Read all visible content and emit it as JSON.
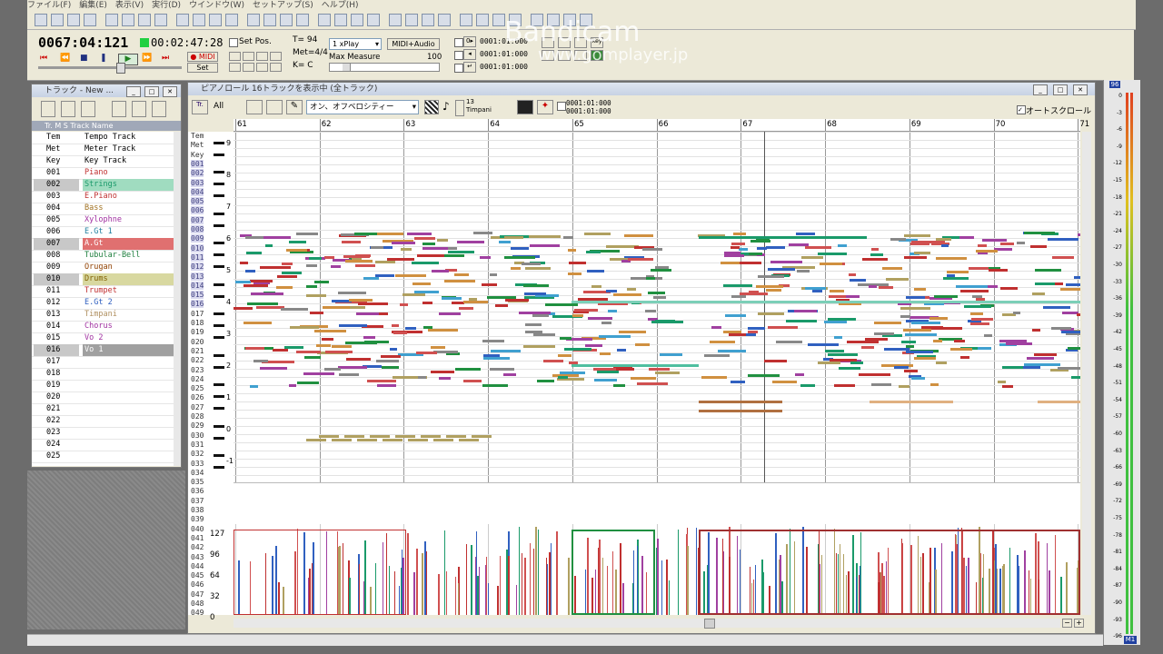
{
  "menu": [
    "ファイル(F)",
    "編集(E)",
    "表示(V)",
    "実行(D)",
    "ウインドウ(W)",
    "セットアップ(S)",
    "ヘルプ(H)"
  ],
  "transport": {
    "measure_pos": "0067:04:121",
    "time_pos": "00:02:47:28",
    "midi_label": "● MIDI",
    "set_label": "Set",
    "set_pos_label": "Set Pos.",
    "tempo": "T=  94",
    "meter": "Met=4/4",
    "key": "K=  C",
    "play_speed": "1 xPlay",
    "mode": "MIDI+Audio",
    "max_measure_label": "Max Measure",
    "max_measure_value": "100",
    "locator1": "0001:01:000",
    "locator2": "0001:01:000",
    "locator3": "0001:01:000",
    "key_label": "Key"
  },
  "watermark": {
    "main": "Bandicam",
    "sub": "www.gomplayer.jp"
  },
  "track_window": {
    "title": "トラック - New ...",
    "header": "Tr. M S  Track Name",
    "tracks": [
      {
        "num": "Tem",
        "name": "Tempo Track",
        "color": ""
      },
      {
        "num": "Met",
        "name": "Meter Track",
        "color": ""
      },
      {
        "num": "Key",
        "name": "Key Track",
        "color": ""
      },
      {
        "num": "001",
        "name": "Piano",
        "color": "#c03030"
      },
      {
        "num": "002",
        "name": "Strings",
        "color": "#1a9a6a",
        "hl": "#a0dcc0"
      },
      {
        "num": "003",
        "name": "E.Piano",
        "color": "#c03030"
      },
      {
        "num": "004",
        "name": "Bass",
        "color": "#a07020"
      },
      {
        "num": "005",
        "name": "Xylophne",
        "color": "#a030a0"
      },
      {
        "num": "006",
        "name": "E.Gt 1",
        "color": "#2080a0"
      },
      {
        "num": "007",
        "name": "A.Gt",
        "color": "#fff",
        "hl": "#e07070"
      },
      {
        "num": "008",
        "name": "Tubular-Bell",
        "color": "#208040"
      },
      {
        "num": "009",
        "name": "Orugan",
        "color": "#904000"
      },
      {
        "num": "010",
        "name": "Drums",
        "color": "#806000",
        "hl": "#d8d8a0"
      },
      {
        "num": "011",
        "name": "Trumpet",
        "color": "#c03030"
      },
      {
        "num": "012",
        "name": "E.Gt 2",
        "color": "#3060c0"
      },
      {
        "num": "013",
        "name": "Timpani",
        "color": "#b09060"
      },
      {
        "num": "014",
        "name": "Chorus",
        "color": "#a030a0"
      },
      {
        "num": "015",
        "name": "Vo 2",
        "color": "#a030a0"
      },
      {
        "num": "016",
        "name": "Vo 1",
        "color": "#fff",
        "hl": "#a0a0a0"
      },
      {
        "num": "017",
        "name": "",
        "color": ""
      },
      {
        "num": "018",
        "name": "",
        "color": ""
      },
      {
        "num": "019",
        "name": "",
        "color": ""
      },
      {
        "num": "020",
        "name": "",
        "color": ""
      },
      {
        "num": "021",
        "name": "",
        "color": ""
      },
      {
        "num": "022",
        "name": "",
        "color": ""
      },
      {
        "num": "023",
        "name": "",
        "color": ""
      },
      {
        "num": "024",
        "name": "",
        "color": ""
      },
      {
        "num": "025",
        "name": "",
        "color": ""
      }
    ]
  },
  "piano_window": {
    "title": "ピアノロール 16トラックを表示中 (全トラック)",
    "all_label": "All",
    "velocity_mode": "オン、オフベロシティー",
    "current_track_num": "13",
    "current_track_name": "Timpani",
    "pos1": "0001:01:000",
    "pos2": "0001:01:000",
    "autoscroll_label": "オートスクロール",
    "measures": [
      "61",
      "62",
      "63",
      "64",
      "65",
      "66",
      "67",
      "68",
      "69",
      "70",
      "71"
    ],
    "octaves": [
      "9",
      "8",
      "7",
      "6",
      "5",
      "4",
      "3",
      "2",
      "1",
      "0",
      "-1"
    ],
    "velocity_ticks": [
      "127",
      "96",
      "64",
      "32",
      "0"
    ],
    "row_labels": [
      "Tem",
      "Met",
      "Key",
      "001",
      "002",
      "003",
      "004",
      "005",
      "006",
      "007",
      "008",
      "009",
      "010",
      "011",
      "012",
      "013",
      "014",
      "015",
      "016",
      "017",
      "018",
      "019",
      "020",
      "021",
      "022",
      "023",
      "024",
      "025",
      "026",
      "027",
      "028",
      "029",
      "030",
      "031",
      "032",
      "033",
      "034",
      "035",
      "036",
      "037",
      "038",
      "039",
      "040",
      "041",
      "042",
      "043",
      "044",
      "045",
      "046",
      "047",
      "048",
      "049"
    ]
  },
  "meters": {
    "top": "96",
    "scale": [
      "0",
      "-3",
      "-6",
      "-9",
      "-12",
      "-15",
      "-18",
      "-21",
      "-24",
      "-27",
      "-30",
      "-33",
      "-36",
      "-39",
      "-42",
      "-45",
      "-48",
      "-51",
      "-54",
      "-57",
      "-60",
      "-63",
      "-66",
      "-69",
      "-72",
      "-75",
      "-78",
      "-81",
      "-84",
      "-87",
      "-90",
      "-93",
      "-96"
    ],
    "bottom": "M1"
  }
}
